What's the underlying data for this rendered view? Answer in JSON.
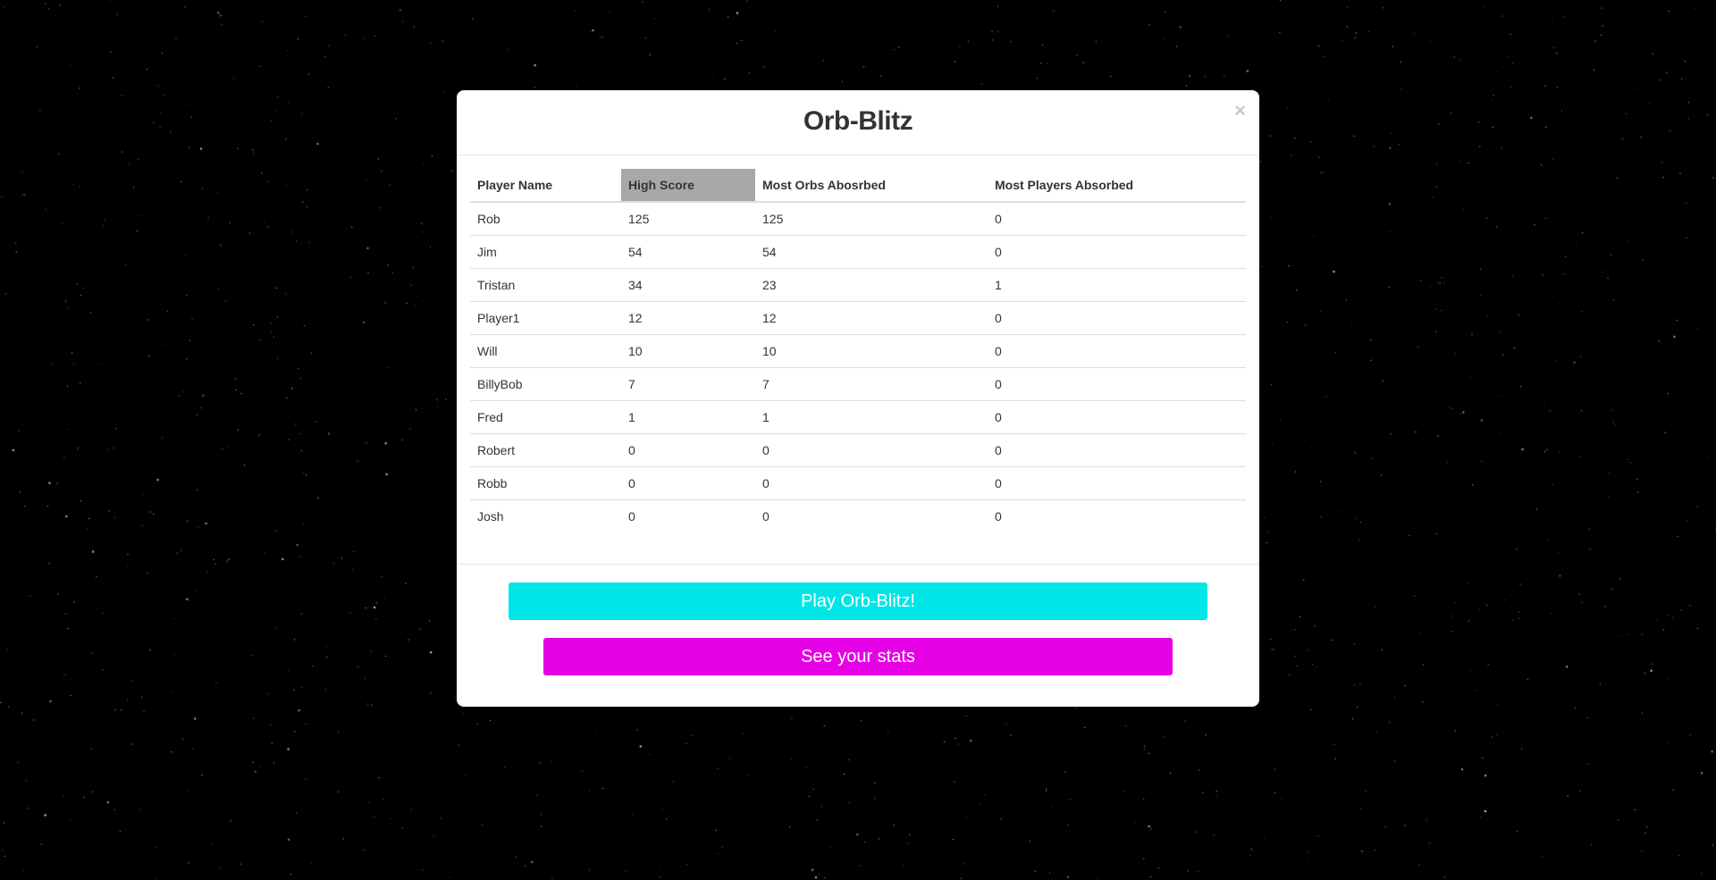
{
  "modal": {
    "title": "Orb-Blitz",
    "close_symbol": "×"
  },
  "table": {
    "headers": [
      "Player Name",
      "High Score",
      "Most Orbs Abosrbed",
      "Most Players Absorbed"
    ],
    "sorted_column": "High Score",
    "rows": [
      [
        "Rob",
        "125",
        "125",
        "0"
      ],
      [
        "Jim",
        "54",
        "54",
        "0"
      ],
      [
        "Tristan",
        "34",
        "23",
        "1"
      ],
      [
        "Player1",
        "12",
        "12",
        "0"
      ],
      [
        "Will",
        "10",
        "10",
        "0"
      ],
      [
        "BillyBob",
        "7",
        "7",
        "0"
      ],
      [
        "Fred",
        "1",
        "1",
        "0"
      ],
      [
        "Robert",
        "0",
        "0",
        "0"
      ],
      [
        "Robb",
        "0",
        "0",
        "0"
      ],
      [
        "Josh",
        "0",
        "0",
        "0"
      ]
    ]
  },
  "buttons": {
    "play_label": "Play Orb-Blitz!",
    "stats_label": "See your stats"
  },
  "colors": {
    "background": "#000000",
    "play_button": "#00e6e6",
    "stats_button": "#e600e6",
    "sorted_header": "#a8a8a8"
  }
}
